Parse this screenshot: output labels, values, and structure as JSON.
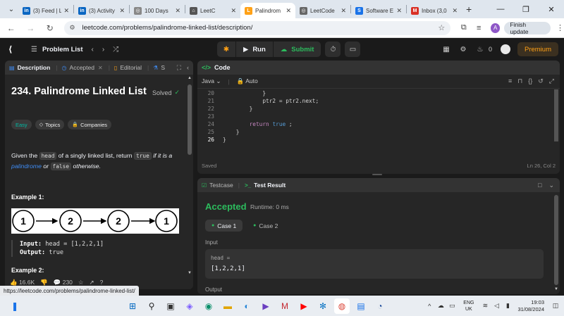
{
  "browser": {
    "tabs": [
      {
        "title": "(3) Feed | L",
        "icon": "linkedin-icon",
        "color": "#0a66c2",
        "glyph": "in"
      },
      {
        "title": "(3) Activity",
        "icon": "linkedin-icon",
        "color": "#0a66c2",
        "glyph": "in"
      },
      {
        "title": "100 Days ",
        "icon": "generic-icon",
        "color": "#888888",
        "glyph": "◎"
      },
      {
        "title": "LeetC",
        "icon": "leetcode-icon",
        "color": "#555555",
        "glyph": "⌂"
      },
      {
        "title": "Palindrom",
        "icon": "leetcode-icon",
        "color": "#ffa116",
        "glyph": "L"
      },
      {
        "title": "LeetCode",
        "icon": "generic-icon",
        "color": "#666666",
        "glyph": "◎"
      },
      {
        "title": "Software E",
        "icon": "s-icon",
        "color": "#1a73e8",
        "glyph": "S"
      },
      {
        "title": "Inbox (3,0",
        "icon": "gmail-icon",
        "color": "#d93025",
        "glyph": "M"
      }
    ],
    "url": "leetcode.com/problems/palindrome-linked-list/description/",
    "avatar_letter": "A",
    "update_label": "Finish update",
    "status_url": "https://leetcode.com/problems/palindrome-linked-list/"
  },
  "lc_nav": {
    "problem_list": "Problem List",
    "run": "Run",
    "submit": "Submit",
    "streak": "0",
    "premium": "Premium"
  },
  "left_panel": {
    "tabs": [
      {
        "label": "Description",
        "active": true
      },
      {
        "label": "Accepted",
        "active": false
      },
      {
        "label": "Editorial",
        "active": false
      },
      {
        "label": "S",
        "active": false
      }
    ],
    "title": "234. Palindrome Linked List",
    "solved": "Solved",
    "tags": [
      "Easy",
      "Topics",
      "Companies"
    ],
    "desc": {
      "p1": "Given the ",
      "code1": "head",
      "p2": " of a singly linked list, return ",
      "code2": "true",
      "p3": " if it is a ",
      "link": "palindrome",
      "p4": " or ",
      "code3": "false",
      "p5": " otherwise."
    },
    "example1_title": "Example 1:",
    "example1_nodes": [
      "1",
      "2",
      "2",
      "1"
    ],
    "example1_input_label": "Input:",
    "example1_input": " head = [1,2,2,1]",
    "example1_output_label": "Output:",
    "example1_output": " true",
    "example2_title": "Example 2:",
    "likes": "16.6K",
    "comments": "230"
  },
  "code_panel": {
    "title": "Code",
    "language": "Java",
    "mode": "Auto",
    "lines": [
      {
        "n": "20",
        "indent": "            ",
        "tokens": [
          {
            "t": "}",
            "c": ""
          }
        ]
      },
      {
        "n": "21",
        "indent": "            ",
        "tokens": [
          {
            "t": "ptr2 = ptr2.next;",
            "c": ""
          }
        ]
      },
      {
        "n": "22",
        "indent": "        ",
        "tokens": [
          {
            "t": "}",
            "c": ""
          }
        ]
      },
      {
        "n": "23",
        "indent": "",
        "tokens": [
          {
            "t": "",
            "c": ""
          }
        ]
      },
      {
        "n": "24",
        "indent": "        ",
        "tokens": [
          {
            "t": "return",
            "c": "kw2"
          },
          {
            "t": " ",
            "c": ""
          },
          {
            "t": "true",
            "c": "kw"
          },
          {
            "t": " ;",
            "c": ""
          }
        ]
      },
      {
        "n": "25",
        "indent": "    ",
        "tokens": [
          {
            "t": "}",
            "c": ""
          }
        ]
      },
      {
        "n": "26",
        "indent": "",
        "tokens": [
          {
            "t": "}",
            "c": ""
          }
        ]
      }
    ],
    "saved": "Saved",
    "cursor": "Ln 26, Col 2"
  },
  "result_panel": {
    "testcase_tab": "Testcase",
    "result_tab": "Test Result",
    "status": "Accepted",
    "runtime": "Runtime: 0 ms",
    "cases": [
      "Case 1",
      "Case 2"
    ],
    "input_label": "Input",
    "var_name": "head =",
    "var_value": "[1,2,2,1]",
    "output_label": "Output"
  },
  "taskbar": {
    "lang_top": "ENG",
    "lang_bottom": "UK",
    "time": "19:03",
    "date": "31/08/2024"
  }
}
